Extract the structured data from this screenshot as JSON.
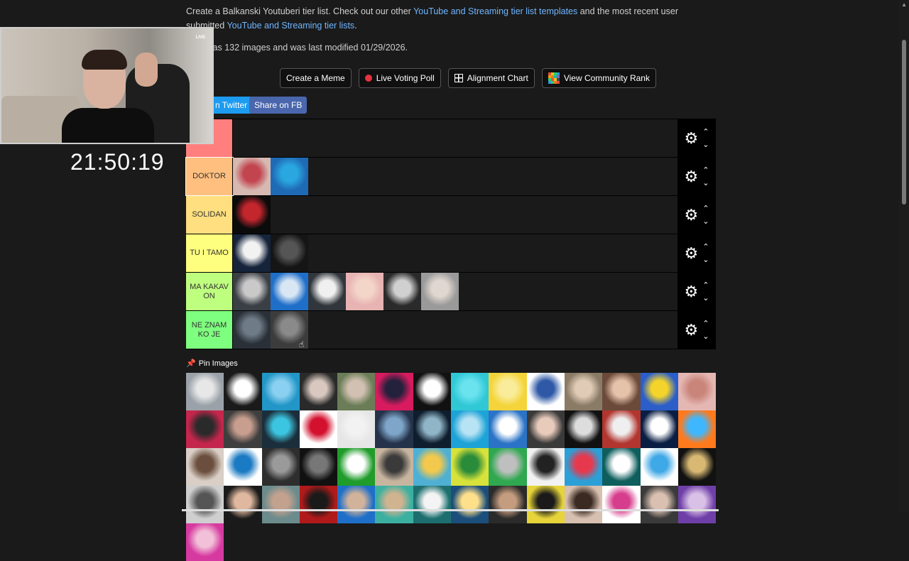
{
  "intro": {
    "text1": "Create a Balkanski Youtuberi tier list. Check out our other ",
    "link1": "YouTube and Streaming tier list templates",
    "text2": " and the most recent user submitted ",
    "link2": "YouTube and Streaming tier lists",
    "text3": "."
  },
  "meta": {
    "text": "plate has 132 images and was last modified 01/29/2026."
  },
  "buttons": {
    "meme": "Create a Meme",
    "poll": "Live Voting Poll",
    "alignment": "Alignment Chart",
    "community": "View Community Rank"
  },
  "share": {
    "twitter": "n Twitter",
    "fb": "Share on FB"
  },
  "tiers": [
    {
      "label": "T",
      "color": "#ff7f7f",
      "items": []
    },
    {
      "label": "DOKTOR",
      "color": "#ffbf7f",
      "items": [
        [
          "#d7b9b2",
          "#c2444f"
        ],
        [
          "#1f6ab5",
          "#2aa7de"
        ]
      ]
    },
    {
      "label": "SOLIDAN",
      "color": "#ffdf7f",
      "items": [
        [
          "#0b0b0b",
          "#c4262e"
        ]
      ]
    },
    {
      "label": "TU I TAMO",
      "color": "#ffff7f",
      "items": [
        [
          "#15233b",
          "#f2f2f2"
        ],
        [
          "#151515",
          "#555555"
        ]
      ]
    },
    {
      "label": "MA KAKAV ON",
      "color": "#bfff7f",
      "items": [
        [
          "#3a3f45",
          "#c9c9c9"
        ],
        [
          "#1f6fc9",
          "#d9e7f5"
        ],
        [
          "#30363b",
          "#f0f0f0"
        ],
        [
          "#e7b3b3",
          "#f4d6c9"
        ],
        [
          "#2a2a2a",
          "#d0d0d0"
        ],
        [
          "#9a9a9a",
          "#e0d7d0"
        ]
      ]
    },
    {
      "label": "NE ZNAM KO JE",
      "color": "#7fff7f",
      "items": [
        [
          "#2a3038",
          "#6f7c88"
        ],
        [
          "#3c3c3c",
          "#8a8a8a"
        ]
      ]
    }
  ],
  "pin": {
    "label": "Pin Images"
  },
  "pool": [
    [
      "#9aa1a8",
      "#e7e7e7"
    ],
    [
      "#1a1a1a",
      "#ffffff"
    ],
    [
      "#2296c7",
      "#8ad0f0"
    ],
    [
      "#2a2a2a",
      "#d8c8bf"
    ],
    [
      "#6a7d56",
      "#d2c0b2"
    ],
    [
      "#d81b5f",
      "#23213c"
    ],
    [
      "#111111",
      "#ffffff"
    ],
    [
      "#31c8d6",
      "#6ae3ee"
    ],
    [
      "#f4d43a",
      "#f9ed9b"
    ],
    [
      "#ffffff",
      "#2f59a6"
    ],
    [
      "#8a7b66",
      "#e0cbb6"
    ],
    [
      "#6b4a3a",
      "#e5c2aa"
    ],
    [
      "#2b5ec9",
      "#f4d42a"
    ],
    [
      "#e5b7b3",
      "#c9857a"
    ],
    [
      "#c4264c",
      "#2a2a2a"
    ],
    [
      "#3e3e3e",
      "#c89e8e"
    ],
    [
      "#1b2e3b",
      "#3cc5e0"
    ],
    [
      "#ffffff",
      "#d3112f"
    ],
    [
      "#e6e6e6",
      "#f2f2f2"
    ],
    [
      "#24324a",
      "#7fa6c9"
    ],
    [
      "#0f1e2e",
      "#8fb5c7"
    ],
    [
      "#1ea3d6",
      "#b8e3f4"
    ],
    [
      "#2a73c7",
      "#ffffff"
    ],
    [
      "#3a3a3a",
      "#e8cbbb"
    ],
    [
      "#111111",
      "#dddddd"
    ],
    [
      "#b2352f",
      "#efefef"
    ],
    [
      "#0a1e44",
      "#ffffff"
    ],
    [
      "#ff7a1c",
      "#3fb7ff"
    ],
    [
      "#d9cfc6",
      "#6b4e3d"
    ],
    [
      "#ffffff",
      "#1a7ac3"
    ],
    [
      "#2e2e2e",
      "#9a9a9a"
    ],
    [
      "#111111",
      "#777777"
    ],
    [
      "#1f9c2a",
      "#ffffff"
    ],
    [
      "#c8b59f",
      "#3a3a3a"
    ],
    [
      "#4fb0d3",
      "#f2c94c"
    ],
    [
      "#d7e23a",
      "#2a8b3a"
    ],
    [
      "#2fa84f",
      "#bfbfbf"
    ],
    [
      "#f2f2f2",
      "#222222"
    ],
    [
      "#2c9fd6",
      "#e7394e"
    ],
    [
      "#0f5e5e",
      "#ffffff"
    ],
    [
      "#ffffff",
      "#3fa8e6"
    ],
    [
      "#111111",
      "#d8b873"
    ],
    [
      "#cfcfcf",
      "#555555"
    ],
    [
      "#1a1a1a",
      "#e0b89f"
    ],
    [
      "#6c8b8c",
      "#c3a18f"
    ],
    [
      "#b11a1a",
      "#1a1a1a"
    ],
    [
      "#1f6fc9",
      "#d1b39b"
    ],
    [
      "#3bb0a1",
      "#d0b38f"
    ],
    [
      "#1d6f6f",
      "#f4f4f4"
    ],
    [
      "#1b4e7a",
      "#ffe08a"
    ],
    [
      "#2b2b2b",
      "#c49c7e"
    ],
    [
      "#e6d43a",
      "#1a1a1a"
    ],
    [
      "#d8c0b0",
      "#3a2a22"
    ],
    [
      "#ffffff",
      "#d73d8d"
    ],
    [
      "#3a3a3a",
      "#d9c0b0"
    ],
    [
      "#6f3fa8",
      "#d9c0e6"
    ],
    [
      "#d63aa0",
      "#f2c0d8"
    ]
  ],
  "cam": {
    "live": "LIVE"
  },
  "clock": "21:50:19",
  "colors": {
    "poll_dot": "#e4323f",
    "twitter": "#1d9bf0",
    "fb": "#4a67ad"
  }
}
